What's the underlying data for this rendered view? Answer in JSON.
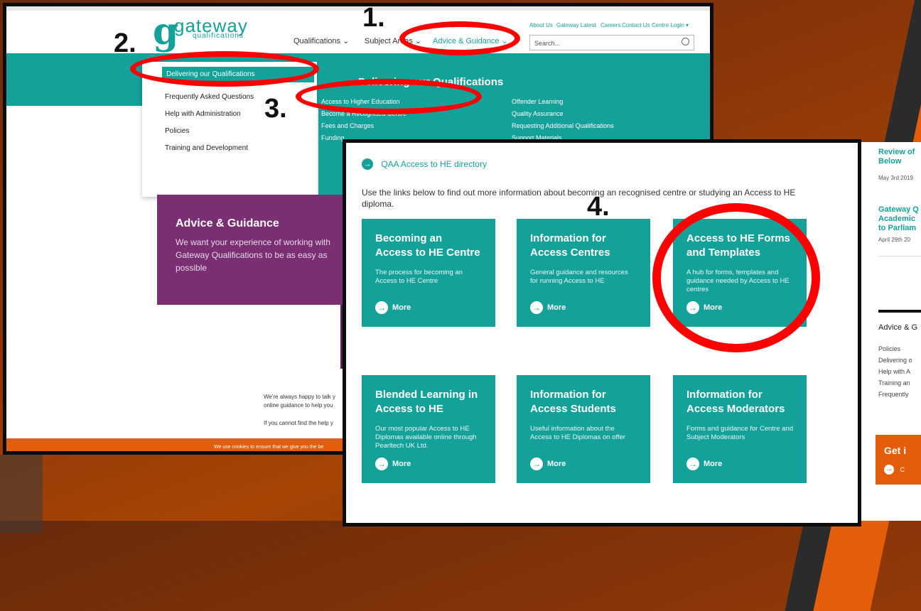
{
  "brand": {
    "logo_letter": "g",
    "logo_word": "gateway",
    "logo_sub": "qualifications"
  },
  "nav": {
    "qualifications": "Qualifications ⌄",
    "subject_areas": "Subject Areas ⌄",
    "advice": "Advice & Guidance ⌄",
    "top_links": [
      "About Us",
      "Gateway Latest",
      "Careers",
      "Contact Us",
      "Centre Login ▾"
    ],
    "search_placeholder": "Search..."
  },
  "menu_left": {
    "active": "Delivering our Qualifications",
    "items": [
      "Frequently Asked Questions",
      "Help with Administration",
      "Policies",
      "Training and Development"
    ]
  },
  "menu_right": {
    "title": "Delivering our Qualifications",
    "col1": [
      "Access to Higher Education",
      "Become a Recognised Centre",
      "Fees and Charges",
      "Funding"
    ],
    "col2": [
      "Offender Learning",
      "Quality Assurance",
      "Requesting Additional Qualifications",
      "Support Materials"
    ]
  },
  "advice_panel": {
    "title": "Advice & Guidance",
    "text": "We want your experience of working with Gateway Qualifications to be as easy as possible"
  },
  "ss1_text": {
    "help1": "We're always happy to talk y",
    "help2": "online guidance to help you",
    "help3": "If you cannot find the help y",
    "cookies": "We use cookies to ensure that we give you the be"
  },
  "qaa": {
    "icon": "arrow-right-icon",
    "label": "QAA Access to HE directory"
  },
  "intro": "Use the links below to find out more information about becoming an recognised centre or studying an Access to HE diploma.",
  "cards": [
    {
      "title": "Becoming an Access to HE Centre",
      "desc": "The process for becoming an Access to HE Centre",
      "more": "More"
    },
    {
      "title": "Information for Access Centres",
      "desc": "General guidance and resources for running Access to HE",
      "more": "More"
    },
    {
      "title": "Access to HE Forms and Templates",
      "desc": "A hub for forms, templates and guidance needed by Access to HE centres",
      "more": "More"
    },
    {
      "title": "Blended Learning in Access to HE",
      "desc": "Our most popular Access to HE Diplomas available online through Pearltech UK Ltd.",
      "more": "More"
    },
    {
      "title": "Information for Access Students",
      "desc": "Useful information about the Access to HE Diplomas on offer",
      "more": "More"
    },
    {
      "title": "Information for Access Moderators",
      "desc": "Forms and guidance for Centre and Subject Moderators",
      "more": "More"
    }
  ],
  "sidebar": {
    "news1_title": "Review of\nBelow",
    "news1_date": "May 3rd 2019",
    "news2_title": "Gateway Q\nAcademic\nto Parliam",
    "news2_date": "April 29th 20",
    "heading": "Advice & G",
    "items": [
      "Policies",
      "Delivering o",
      "Help with A",
      "Training an",
      "Frequently"
    ],
    "cta_title": "Get i",
    "cta_link": "C"
  },
  "steps": [
    "1.",
    "2.",
    "3.",
    "4."
  ],
  "colors": {
    "teal": "#14a19a",
    "orange": "#e35d0a",
    "purple": "#7a2f73",
    "annotation_red": "#ff0000"
  }
}
